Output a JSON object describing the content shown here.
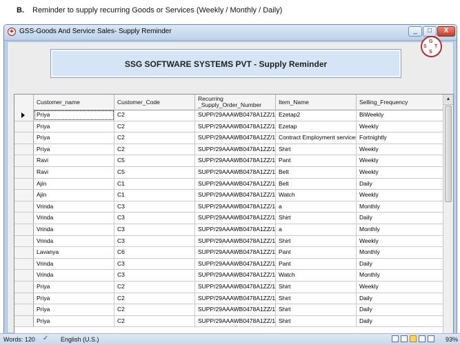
{
  "document": {
    "marker": "B.",
    "heading": "Reminder to supply recurring Goods or Services (Weekly / Monthly / Daily)"
  },
  "window": {
    "title": "GSS-Goods And Service Sales- Supply Reminder",
    "minimize_symbol": "_",
    "maximize_symbol": "□",
    "close_symbol": "X"
  },
  "banner": {
    "title": "SSG SOFTWARE SYSTEMS PVT - Supply Reminder",
    "logo_letters": [
      "G",
      "S",
      "T",
      "S"
    ],
    "logo_color": "#c0262d"
  },
  "grid": {
    "columns": [
      {
        "key": "name",
        "label": "Customer_name"
      },
      {
        "key": "code",
        "label": "Customer_Code"
      },
      {
        "key": "order",
        "label": "Recurring _Supply_Order_Number"
      },
      {
        "key": "item",
        "label": "Item_Name"
      },
      {
        "key": "freq",
        "label": "Selling_Frequency"
      }
    ],
    "rows": [
      [
        "Priya",
        "C2",
        "SUPP/29AAAWB0478A1ZZ/1...",
        "Ezetap2",
        "BiWeekly"
      ],
      [
        "Priya",
        "C2",
        "SUPP/29AAAWB0478A1ZZ/1...",
        "Ezetap",
        "Weekly"
      ],
      [
        "Priya",
        "C2",
        "SUPP/29AAAWB0478A1ZZ/1...",
        "Contract Employment services",
        "Fortnightly"
      ],
      [
        "Priya",
        "C2",
        "SUPP/29AAAWB0478A1ZZ/1...",
        "Shirt",
        "Weekly"
      ],
      [
        "Ravi",
        "C5",
        "SUPP/29AAAWB0478A1ZZ/1...",
        "Pant",
        "Weekly"
      ],
      [
        "Ravi",
        "C5",
        "SUPP/29AAAWB0478A1ZZ/1...",
        "Belt",
        "Weekly"
      ],
      [
        "Ajin",
        "C1",
        "SUPP/29AAAWB0478A1ZZ/1...",
        "Belt",
        "Daily"
      ],
      [
        "Ajin",
        "C1",
        "SUPP/29AAAWB0478A1ZZ/1...",
        "Watch",
        "Weekly"
      ],
      [
        "Vrinda",
        "C3",
        "SUPP/29AAAWB0478A1ZZ/1...",
        "a",
        "Monthly"
      ],
      [
        "Vrinda",
        "C3",
        "SUPP/29AAAWB0478A1ZZ/1...",
        "Shirt",
        "Daily"
      ],
      [
        "Vrinda",
        "C3",
        "SUPP/29AAAWB0478A1ZZ/1...",
        "a",
        "Monthly"
      ],
      [
        "Vrinda",
        "C3",
        "SUPP/29AAAWB0478A1ZZ/1...",
        "Shirt",
        "Weekly"
      ],
      [
        "Lavanya",
        "C6",
        "SUPP/29AAAWB0478A1ZZ/1...",
        "Pant",
        "Monthly"
      ],
      [
        "Vrinda",
        "C3",
        "SUPP/29AAAWB0478A1ZZ/1...",
        "Pant",
        "Daily"
      ],
      [
        "Vrinda",
        "C3",
        "SUPP/29AAAWB0478A1ZZ/1...",
        "Watch",
        "Monthly"
      ],
      [
        "Priya",
        "C2",
        "SUPP/29AAAWB0478A1ZZ/1...",
        "Shirt",
        "Weekly"
      ],
      [
        "Priya",
        "C2",
        "SUPP/29AAAWB0478A1ZZ/1...",
        "Shirt",
        "Daily"
      ],
      [
        "Priya",
        "C2",
        "SUPP/29AAAWB0478A1ZZ/1...",
        "Shirt",
        "Daily"
      ],
      [
        "Priya",
        "C2",
        "SUPP/29AAAWB0478A1ZZ/1...",
        "Shirt",
        "Daily"
      ]
    ],
    "selected_row": 0
  },
  "statusbar": {
    "words": "Words: 120",
    "language": "English (U.S.)",
    "zoom": "93%"
  }
}
